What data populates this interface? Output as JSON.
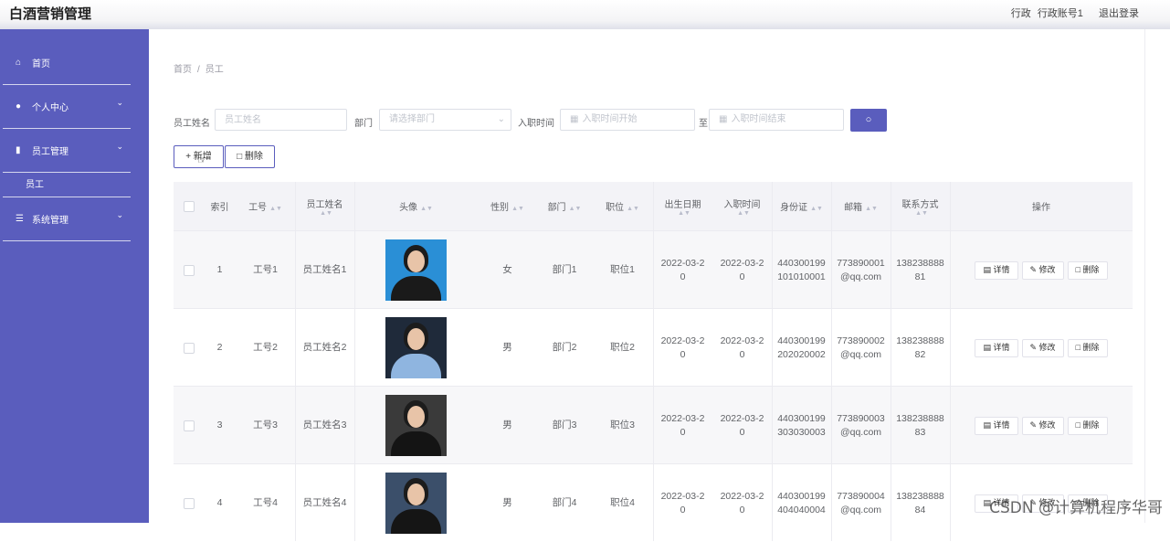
{
  "header": {
    "title": "白酒营销管理",
    "user_role": "行政",
    "user_account": "行政账号1",
    "logout_label": "退出登录"
  },
  "sidebar": {
    "items": [
      {
        "label": "首页",
        "icon": "home-icon",
        "has_children": false
      },
      {
        "label": "个人中心",
        "icon": "user-icon",
        "has_children": true
      },
      {
        "label": "员工管理",
        "icon": "clipboard-icon",
        "has_children": true
      },
      {
        "label": "系统管理",
        "icon": "list-icon",
        "has_children": true
      }
    ],
    "sub_item": "员工"
  },
  "breadcrumb": {
    "home": "首页",
    "separator": "/",
    "current": "员工"
  },
  "filters": {
    "name_label": "员工姓名",
    "name_placeholder": "员工姓名",
    "dept_label": "部门",
    "dept_placeholder": "请选择部门",
    "date_label": "入职时间",
    "date_start_placeholder": "入职时间开始",
    "date_to": "至",
    "date_end_placeholder": "入职时间结束"
  },
  "toolbar": {
    "add_label": "+ 新增",
    "delete_label": "删除"
  },
  "table": {
    "headers": {
      "index": "索引",
      "emp_no": "工号",
      "name": "员工姓名",
      "avatar": "头像",
      "gender": "性别",
      "dept": "部门",
      "position": "职位",
      "birth": "出生日期",
      "join": "入职时间",
      "id_card": "身份证",
      "email": "邮箱",
      "phone": "联系方式",
      "actions": "操作"
    },
    "action_labels": {
      "detail": "详情",
      "edit": "修改",
      "delete": "删除"
    },
    "rows": [
      {
        "index": "1",
        "emp_no": "工号1",
        "name": "员工姓名1",
        "gender": "女",
        "dept": "部门1",
        "position": "职位1",
        "birth_1": "2022-03-2",
        "birth_2": "0",
        "join_1": "2022-03-2",
        "join_2": "0",
        "id_1": "440300199",
        "id_2": "101010001",
        "email_1": "773890001",
        "email_2": "@qq.com",
        "phone_1": "138238888",
        "phone_2": "81",
        "photo_bg": "#2a8fd6",
        "photo_body": "#1a1a1a"
      },
      {
        "index": "2",
        "emp_no": "工号2",
        "name": "员工姓名2",
        "gender": "男",
        "dept": "部门2",
        "position": "职位2",
        "birth_1": "2022-03-2",
        "birth_2": "0",
        "join_1": "2022-03-2",
        "join_2": "0",
        "id_1": "440300199",
        "id_2": "202020002",
        "email_1": "773890002",
        "email_2": "@qq.com",
        "phone_1": "138238888",
        "phone_2": "82",
        "photo_bg": "#1f2a3a",
        "photo_body": "#8fb5e0"
      },
      {
        "index": "3",
        "emp_no": "工号3",
        "name": "员工姓名3",
        "gender": "男",
        "dept": "部门3",
        "position": "职位3",
        "birth_1": "2022-03-2",
        "birth_2": "0",
        "join_1": "2022-03-2",
        "join_2": "0",
        "id_1": "440300199",
        "id_2": "303030003",
        "email_1": "773890003",
        "email_2": "@qq.com",
        "phone_1": "138238888",
        "phone_2": "83",
        "photo_bg": "#3a3a3a",
        "photo_body": "#141414"
      },
      {
        "index": "4",
        "emp_no": "工号4",
        "name": "员工姓名4",
        "gender": "男",
        "dept": "部门4",
        "position": "职位4",
        "birth_1": "2022-03-2",
        "birth_2": "0",
        "join_1": "2022-03-2",
        "join_2": "0",
        "id_1": "440300199",
        "id_2": "404040004",
        "email_1": "773890004",
        "email_2": "@qq.com",
        "phone_1": "138238888",
        "phone_2": "84",
        "photo_bg": "#3b4f6a",
        "photo_body": "#151515"
      }
    ]
  },
  "colors": {
    "accent": "#5a5dbd",
    "header_bg": "#f4f4f6",
    "table_head_bg": "#f3f3f7"
  },
  "watermark": "CSDN @计算机程序华哥"
}
